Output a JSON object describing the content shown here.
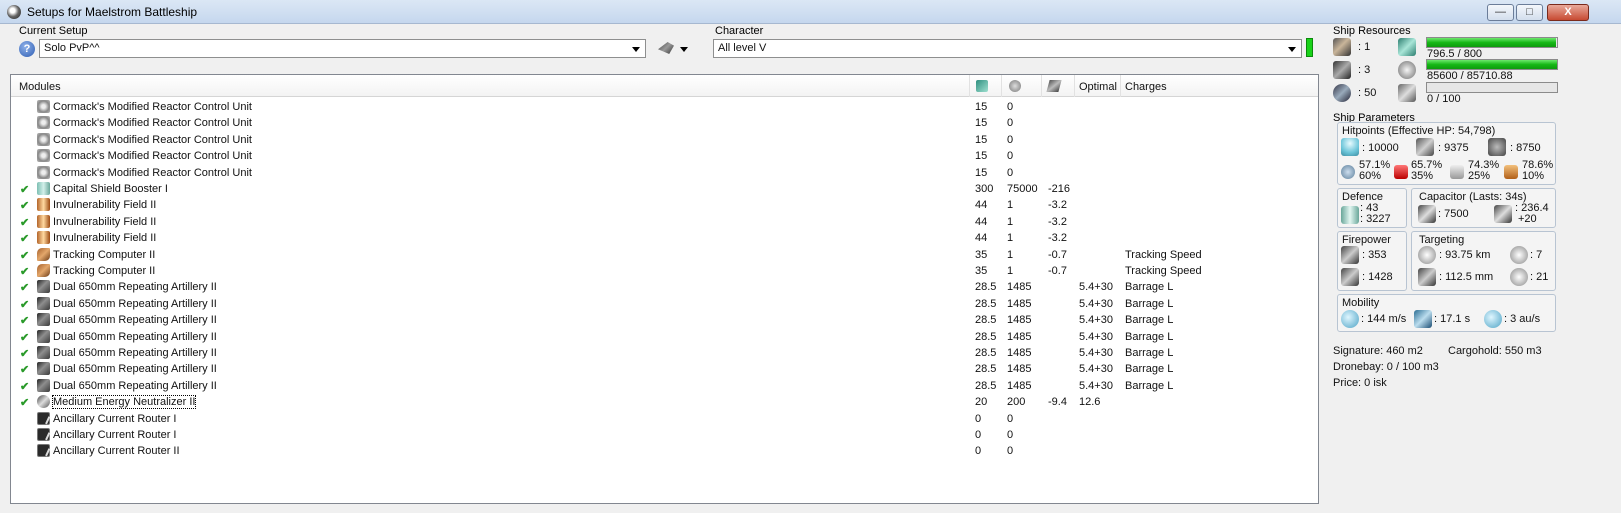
{
  "window": {
    "title": "Setups for Maelstrom Battleship",
    "min": "—",
    "max": "□",
    "close": "X"
  },
  "setup": {
    "label": "Current Setup",
    "value": "Solo PvP^^"
  },
  "character": {
    "label": "Character",
    "value": "All level V"
  },
  "modules": {
    "headers": {
      "name": "Modules",
      "optimal": "Optimal",
      "charges": "Charges"
    },
    "rows": [
      {
        "fitted": false,
        "icon": "reactor-icon",
        "name": "Cormack's Modified Reactor Control Unit",
        "cpu": "15",
        "pg": "0",
        "cap": "",
        "optimal": "",
        "charge": ""
      },
      {
        "fitted": false,
        "icon": "reactor-icon",
        "name": "Cormack's Modified Reactor Control Unit",
        "cpu": "15",
        "pg": "0",
        "cap": "",
        "optimal": "",
        "charge": ""
      },
      {
        "fitted": false,
        "icon": "reactor-icon",
        "name": "Cormack's Modified Reactor Control Unit",
        "cpu": "15",
        "pg": "0",
        "cap": "",
        "optimal": "",
        "charge": ""
      },
      {
        "fitted": false,
        "icon": "reactor-icon",
        "name": "Cormack's Modified Reactor Control Unit",
        "cpu": "15",
        "pg": "0",
        "cap": "",
        "optimal": "",
        "charge": ""
      },
      {
        "fitted": false,
        "icon": "reactor-icon",
        "name": "Cormack's Modified Reactor Control Unit",
        "cpu": "15",
        "pg": "0",
        "cap": "",
        "optimal": "",
        "charge": ""
      },
      {
        "fitted": true,
        "icon": "shield-booster-icon",
        "name": "Capital Shield Booster I",
        "cpu": "300",
        "pg": "75000",
        "cap": "-216",
        "optimal": "",
        "charge": ""
      },
      {
        "fitted": true,
        "icon": "invulnerability-field-icon",
        "name": "Invulnerability Field II",
        "cpu": "44",
        "pg": "1",
        "cap": "-3.2",
        "optimal": "",
        "charge": ""
      },
      {
        "fitted": true,
        "icon": "invulnerability-field-icon",
        "name": "Invulnerability Field II",
        "cpu": "44",
        "pg": "1",
        "cap": "-3.2",
        "optimal": "",
        "charge": ""
      },
      {
        "fitted": true,
        "icon": "invulnerability-field-icon",
        "name": "Invulnerability Field II",
        "cpu": "44",
        "pg": "1",
        "cap": "-3.2",
        "optimal": "",
        "charge": ""
      },
      {
        "fitted": true,
        "icon": "tracking-computer-icon",
        "name": "Tracking Computer II",
        "cpu": "35",
        "pg": "1",
        "cap": "-0.7",
        "optimal": "",
        "charge": "Tracking Speed"
      },
      {
        "fitted": true,
        "icon": "tracking-computer-icon",
        "name": "Tracking Computer II",
        "cpu": "35",
        "pg": "1",
        "cap": "-0.7",
        "optimal": "",
        "charge": "Tracking Speed"
      },
      {
        "fitted": true,
        "icon": "artillery-icon",
        "name": "Dual 650mm Repeating Artillery II",
        "cpu": "28.5",
        "pg": "1485",
        "cap": "",
        "optimal": "5.4+30",
        "charge": "Barrage L"
      },
      {
        "fitted": true,
        "icon": "artillery-icon",
        "name": "Dual 650mm Repeating Artillery II",
        "cpu": "28.5",
        "pg": "1485",
        "cap": "",
        "optimal": "5.4+30",
        "charge": "Barrage L"
      },
      {
        "fitted": true,
        "icon": "artillery-icon",
        "name": "Dual 650mm Repeating Artillery II",
        "cpu": "28.5",
        "pg": "1485",
        "cap": "",
        "optimal": "5.4+30",
        "charge": "Barrage L"
      },
      {
        "fitted": true,
        "icon": "artillery-icon",
        "name": "Dual 650mm Repeating Artillery II",
        "cpu": "28.5",
        "pg": "1485",
        "cap": "",
        "optimal": "5.4+30",
        "charge": "Barrage L"
      },
      {
        "fitted": true,
        "icon": "artillery-icon",
        "name": "Dual 650mm Repeating Artillery II",
        "cpu": "28.5",
        "pg": "1485",
        "cap": "",
        "optimal": "5.4+30",
        "charge": "Barrage L"
      },
      {
        "fitted": true,
        "icon": "artillery-icon",
        "name": "Dual 650mm Repeating Artillery II",
        "cpu": "28.5",
        "pg": "1485",
        "cap": "",
        "optimal": "5.4+30",
        "charge": "Barrage L"
      },
      {
        "fitted": true,
        "icon": "artillery-icon",
        "name": "Dual 650mm Repeating Artillery II",
        "cpu": "28.5",
        "pg": "1485",
        "cap": "",
        "optimal": "5.4+30",
        "charge": "Barrage L"
      },
      {
        "fitted": true,
        "icon": "energy-neutralizer-icon",
        "name": "Medium Energy Neutralizer II",
        "cpu": "20",
        "pg": "200",
        "cap": "-9.4",
        "optimal": "12.6",
        "charge": "",
        "selected": true
      },
      {
        "fitted": false,
        "icon": "rig-icon",
        "name": "Ancillary Current Router I",
        "cpu": "0",
        "pg": "0",
        "cap": "",
        "optimal": "",
        "charge": ""
      },
      {
        "fitted": false,
        "icon": "rig-icon",
        "name": "Ancillary Current Router I",
        "cpu": "0",
        "pg": "0",
        "cap": "",
        "optimal": "",
        "charge": ""
      },
      {
        "fitted": false,
        "icon": "rig-icon",
        "name": "Ancillary Current Router II",
        "cpu": "0",
        "pg": "0",
        "cap": "",
        "optimal": "",
        "charge": ""
      }
    ]
  },
  "resources": {
    "label": "Ship Resources",
    "turrets": ": 1",
    "launchers": ": 3",
    "calibration": ": 50",
    "cpu": {
      "text": "796.5 / 800",
      "fraction": 0.996
    },
    "powergrid": {
      "text": "85600 / 85710.88",
      "fraction": 0.999
    },
    "calibration_used": {
      "text": "0 / 100",
      "fraction": 0
    }
  },
  "parameters": {
    "label": "Ship Parameters",
    "hitpoints_label": "Hitpoints (Effective HP: 54,798)",
    "shield_hp": ": 10000",
    "armor_hp": ": 9375",
    "structure_hp": ": 8750",
    "resists": [
      {
        "top": "57.1%",
        "bottom": "60%"
      },
      {
        "top": "65.7%",
        "bottom": "35%"
      },
      {
        "top": "74.3%",
        "bottom": "25%"
      },
      {
        "top": "78.6%",
        "bottom": "10%"
      }
    ],
    "defence_label": "Defence",
    "defence_top": ": 43",
    "defence_bottom": ": 3227",
    "capacitor_label": "Capacitor (Lasts: 34s)",
    "capacitor_value": ": 7500",
    "capacitor_rate_top": ": 236.4",
    "capacitor_rate_bottom": "+20",
    "firepower_label": "Firepower",
    "firepower_dps": ": 353",
    "firepower_volley": ": 1428",
    "targeting_label": "Targeting",
    "target_range": ": 93.75 km",
    "max_targets": ": 7",
    "sig_res": ": 112.5 mm",
    "scan_res": ": 21",
    "mobility_label": "Mobility",
    "speed": ": 144 m/s",
    "align": ": 17.1 s",
    "warp": ": 3 au/s"
  },
  "info": {
    "signature": "Signature: 460 m2",
    "cargohold": "Cargohold: 550 m3",
    "dronebay": "Dronebay: 0 / 100 m3",
    "price": "Price: 0 isk"
  }
}
